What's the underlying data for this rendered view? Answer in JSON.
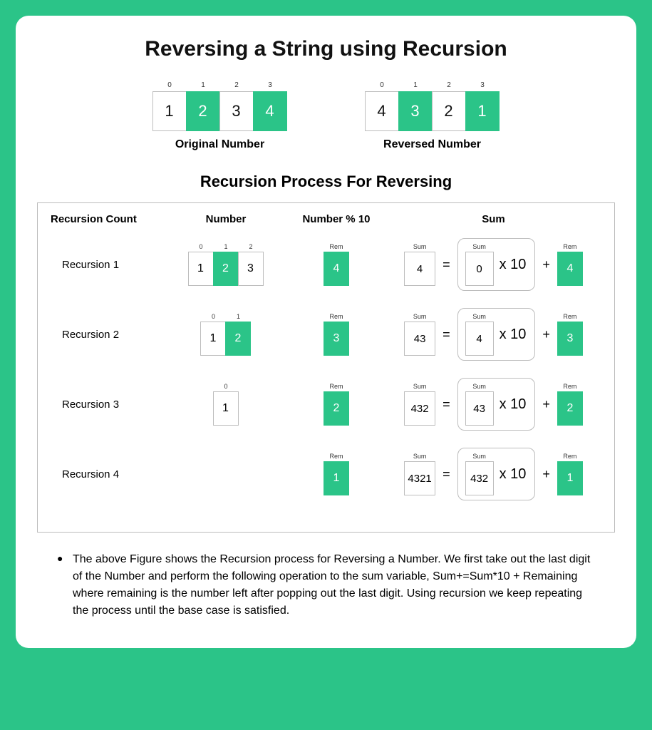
{
  "title": "Reversing a String using Recursion",
  "original": {
    "label": "Original Number",
    "indices": [
      "0",
      "1",
      "2",
      "3"
    ],
    "cells": [
      {
        "v": "1",
        "g": false
      },
      {
        "v": "2",
        "g": true
      },
      {
        "v": "3",
        "g": false
      },
      {
        "v": "4",
        "g": true
      }
    ]
  },
  "reversed": {
    "label": "Reversed Number",
    "indices": [
      "0",
      "1",
      "2",
      "3"
    ],
    "cells": [
      {
        "v": "4",
        "g": false
      },
      {
        "v": "3",
        "g": true
      },
      {
        "v": "2",
        "g": false
      },
      {
        "v": "1",
        "g": true
      }
    ]
  },
  "subtitle": "Recursion Process For Reversing",
  "headers": {
    "count": "Recursion Count",
    "number": "Number",
    "mod": "Number % 10",
    "sum": "Sum"
  },
  "labels": {
    "rem": "Rem",
    "sum": "Sum",
    "times10": "x 10",
    "eq": "=",
    "plus": "+"
  },
  "rows": [
    {
      "label": "Recursion 1",
      "num_indices": [
        "0",
        "1",
        "2"
      ],
      "num_cells": [
        {
          "v": "1",
          "g": false
        },
        {
          "v": "2",
          "g": true
        },
        {
          "v": "3",
          "g": false
        }
      ],
      "rem": "4",
      "sum_out": "4",
      "sum_prev": "0",
      "rem2": "4"
    },
    {
      "label": "Recursion 2",
      "num_indices": [
        "0",
        "1"
      ],
      "num_cells": [
        {
          "v": "1",
          "g": false
        },
        {
          "v": "2",
          "g": true
        }
      ],
      "rem": "3",
      "sum_out": "43",
      "sum_prev": "4",
      "rem2": "3"
    },
    {
      "label": "Recursion 3",
      "num_indices": [
        "0"
      ],
      "num_cells": [
        {
          "v": "1",
          "g": false
        }
      ],
      "rem": "2",
      "sum_out": "432",
      "sum_prev": "43",
      "rem2": "2"
    },
    {
      "label": "Recursion 4",
      "num_indices": [],
      "num_cells": [],
      "rem": "1",
      "sum_out": "4321",
      "sum_prev": "432",
      "rem2": "1"
    }
  ],
  "footer": "The above Figure shows the Recursion process for Reversing a Number. We first take out the last digit of the Number and perform the following operation to the sum variable, Sum+=Sum*10 + Remaining where remaining is the number left after popping out the last digit. Using recursion we keep repeating the process until the base case is satisfied."
}
